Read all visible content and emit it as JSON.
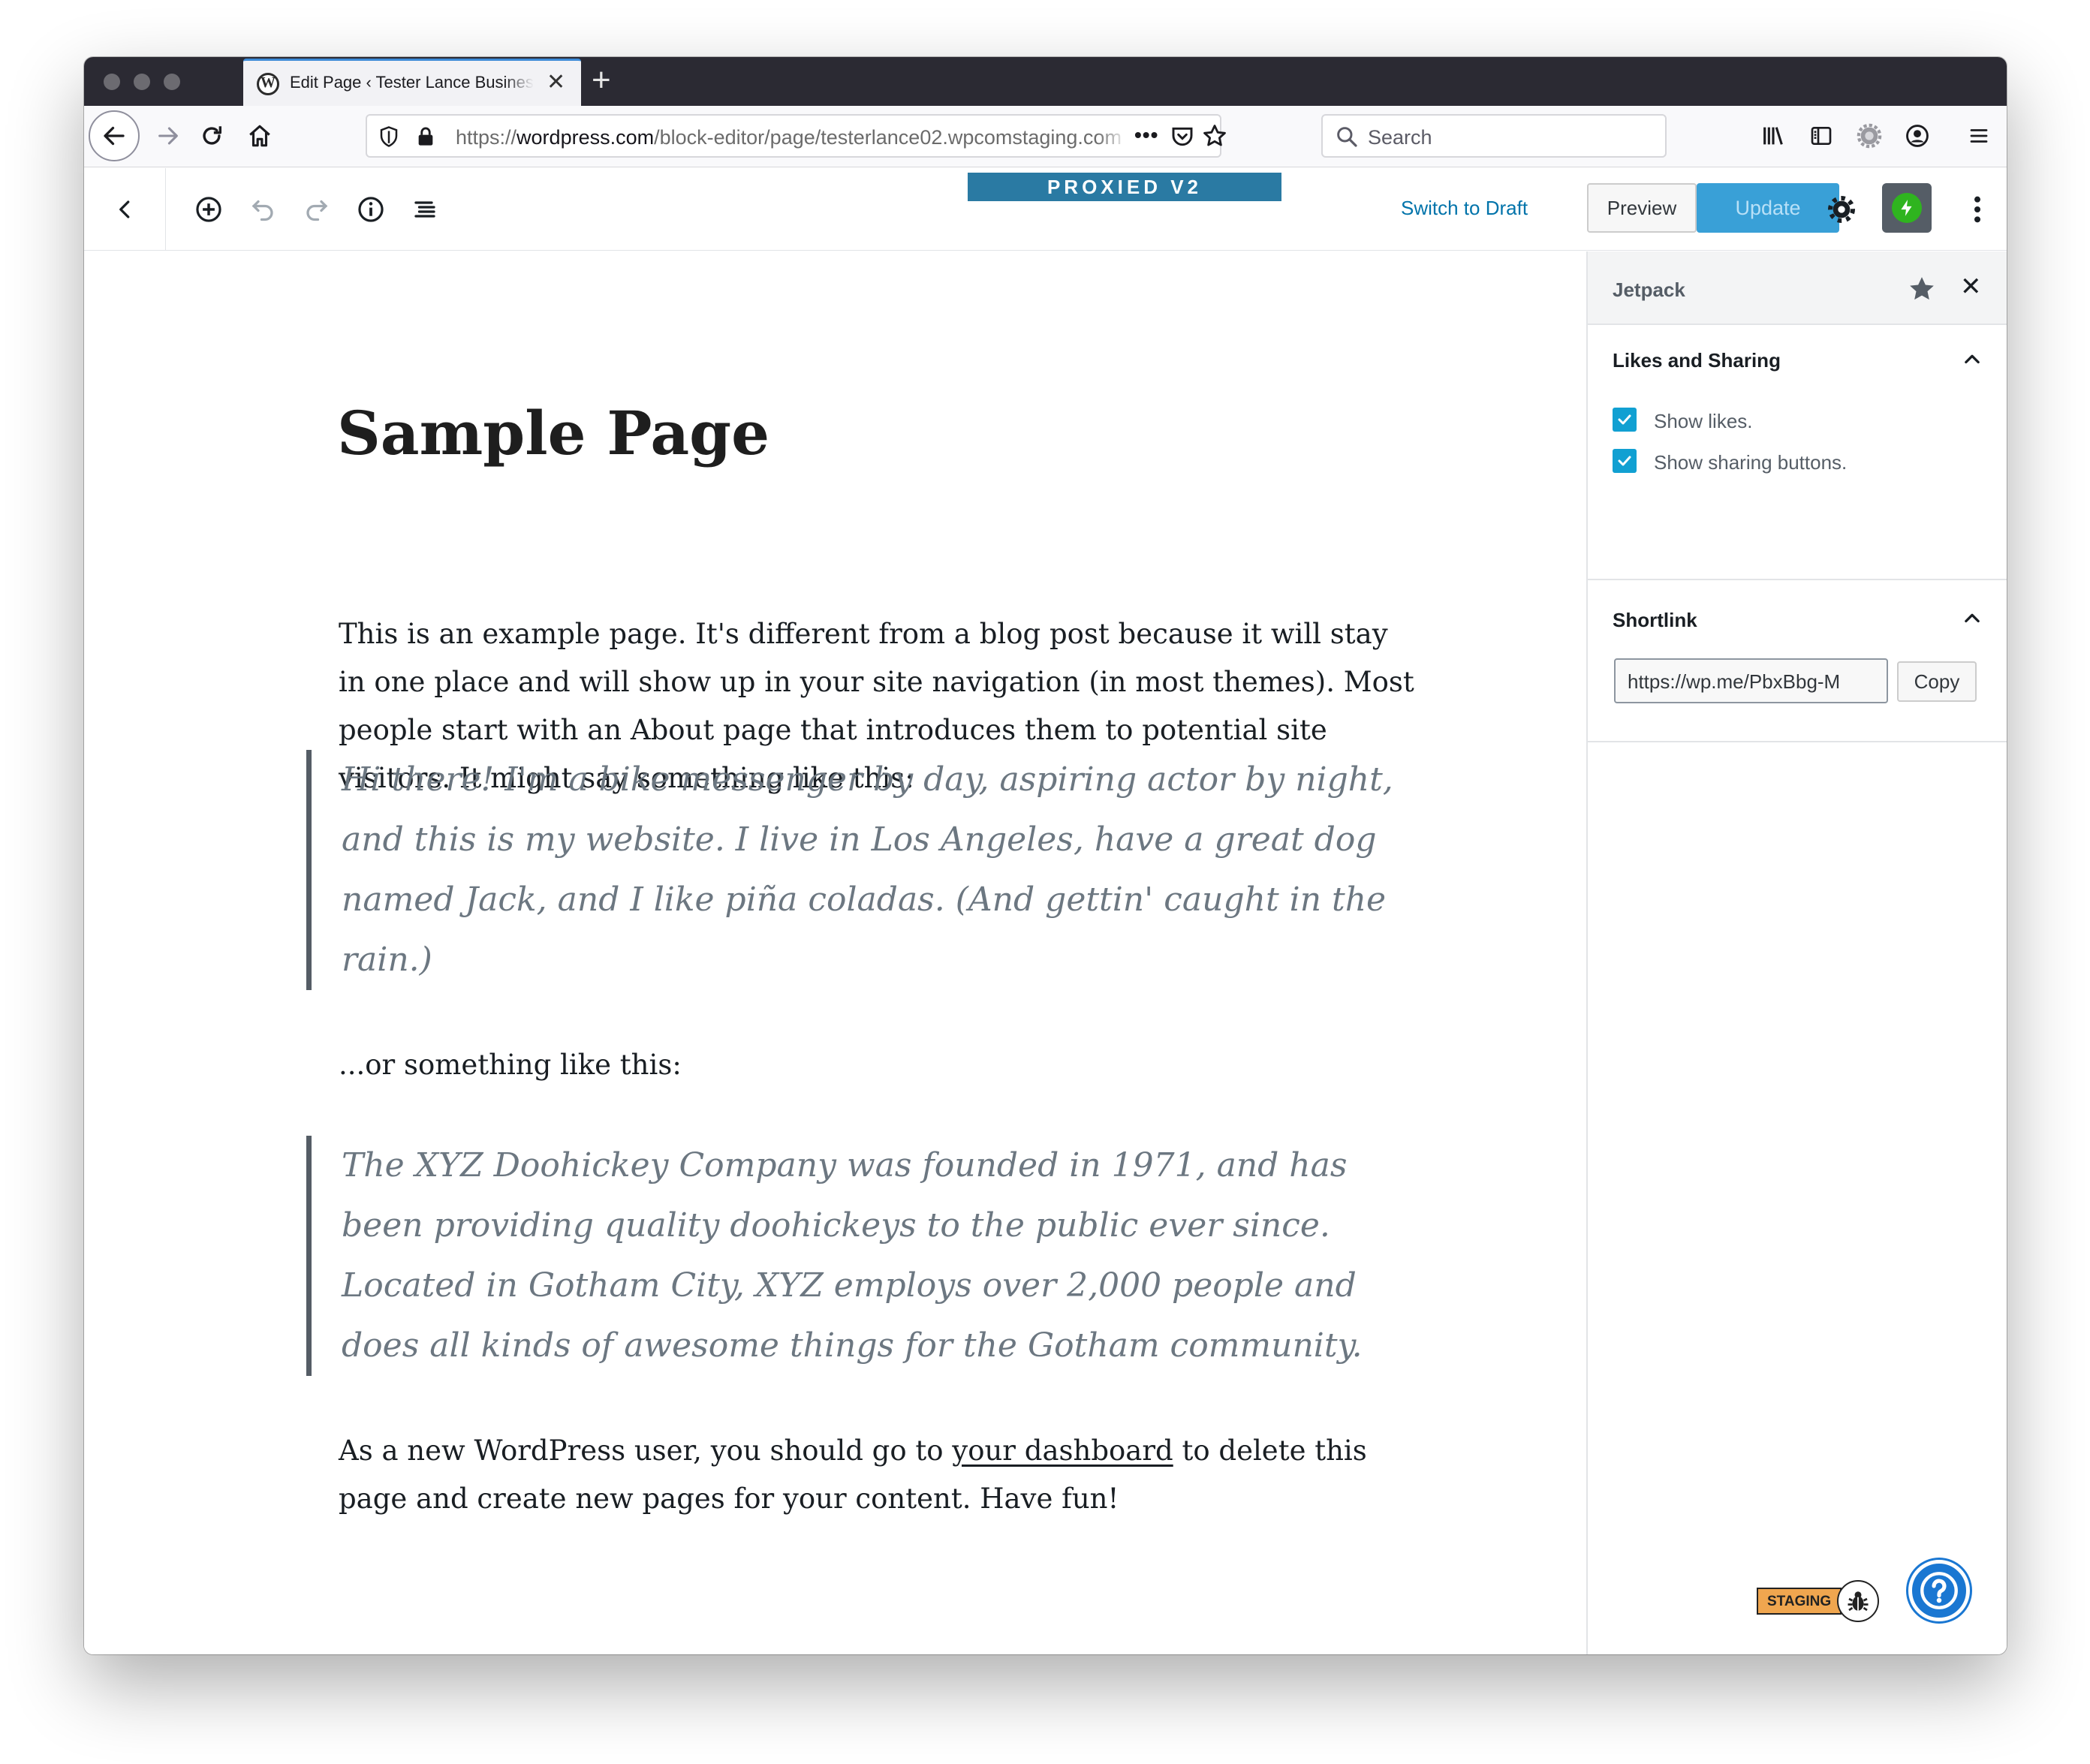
{
  "browser": {
    "tab_title": "Edit Page ‹ Tester Lance Business",
    "url_scheme": "https://",
    "url_host": "wordpress.com",
    "url_path": "/block-editor/page/testerlance02.wpcomstaging.com",
    "search_placeholder": "Search"
  },
  "editor_toolbar": {
    "proxied_label": "PROXIED V2",
    "switch_to_draft": "Switch to Draft",
    "preview": "Preview",
    "update": "Update"
  },
  "content": {
    "title": "Sample Page",
    "intro": "This is an example page. It's different from a blog post because it will stay in one place and will show up in your site navigation (in most themes). Most people start with an About page that introduces them to potential site visitors. It might say something like this:",
    "quote1": "Hi there! I'm a bike messenger by day, aspiring actor by night, and this is my website. I live in Los Angeles, have a great dog named Jack, and I like piña coladas. (And gettin' caught in the rain.)",
    "middle": "...or something like this:",
    "quote2": "The XYZ Doohickey Company was founded in 1971, and has been providing quality doohickeys to the public ever since. Located in Gotham City, XYZ employs over 2,000 people and does all kinds of awesome things for the Gotham community.",
    "outro_before": "As a new WordPress user, you should go to ",
    "outro_link": "your dashboard",
    "outro_after": " to delete this page and create new pages for your content. Have fun!"
  },
  "sidebar": {
    "title": "Jetpack",
    "likes_panel_title": "Likes and Sharing",
    "show_likes": "Show likes.",
    "show_sharing": "Show sharing buttons.",
    "show_likes_checked": true,
    "show_sharing_checked": true,
    "shortlink_panel_title": "Shortlink",
    "shortlink_value": "https://wp.me/PbxBbg-M",
    "copy": "Copy"
  },
  "badges": {
    "staging": "STAGING"
  },
  "colors": {
    "accent": "#0073aa",
    "update_button": "#39a0d7",
    "proxied_banner": "#2a7aa3",
    "jetpack_green": "#2fb41f",
    "checkbox": "#11a0d2",
    "help_button": "#1a77d2",
    "staging_badge": "#f0a64f"
  }
}
